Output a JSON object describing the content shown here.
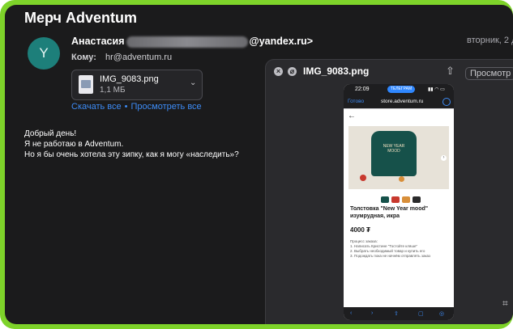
{
  "header": {
    "title": "Мерч Adventum"
  },
  "email": {
    "avatar_letter": "Y",
    "sender_name": "Анастасия",
    "sender_email_suffix": "@yandex.ru>",
    "date": "вторник, 2 д",
    "to_label": "Кому:",
    "to_value": "hr@adventum.ru",
    "attachment": {
      "name": "IMG_9083.png",
      "size": "1,1 МБ"
    },
    "links": {
      "save_all": "Скачать все",
      "view_all": "Просмотреть все"
    },
    "body_lines": [
      "Добрый день!",
      "Я не работаю в Adventum.",
      "Но я бы очень хотела эту зипку, как я могу «наследить»?"
    ]
  },
  "viewer": {
    "title": "IMG_9083.png",
    "preview_label": "Просмотр",
    "phone": {
      "time": "22:09",
      "pill": "ТЕЛЕГРАМ",
      "done": "Готово",
      "host": "store.adventum.ru",
      "shirt_text": "NEW YEAR MOOD",
      "product": "Толстовка \"New Year mood\" изумрудная, икра",
      "price": "4000 ₮",
      "how_to": "Процесс заказа:",
      "how_step1": "1. Написать Кристине \"Тостойте кляше\"",
      "how_step2": "2. Выбрать необходимый товар и купить его",
      "how_step3": "3. Подождать пока не начнём отправлять заказ",
      "highlight": "Кристине"
    }
  }
}
